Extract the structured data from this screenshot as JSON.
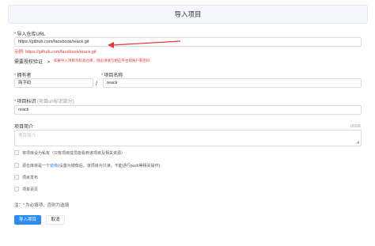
{
  "header": {
    "title": "导入项目"
  },
  "repo_url": {
    "label": "导入仓库URL",
    "value": "https://github.com/facebook/reack.git",
    "example_prefix": "示例:",
    "example_url": "https://github.com/facebook/reack.git"
  },
  "auth": {
    "label": "需要授权验证",
    "toggle_glyph": ">",
    "note": "如果导入项目为私有仓库，则必须填写相应平台的账户和密码"
  },
  "owner": {
    "label": "拥有者",
    "value": "商字码"
  },
  "separator": "/",
  "project_name": {
    "label": "项目名称",
    "value": "reack"
  },
  "project_id": {
    "label": "项目标识",
    "hint": "(项目url标识部分)",
    "value": "reack"
  },
  "description": {
    "label": "项目简介",
    "counter": "0/200",
    "placeholder": "项目简介"
  },
  "options": [
    {
      "label": "将项目设为私有（只有项目成员能看到该项目及相关资源）"
    },
    {
      "label_before": "源仓库将是一个",
      "link": "镜像",
      "label_after": "(设置为镜像后，该项目为只读，不能进行push等相关操作)"
    },
    {
      "label": "项目发布"
    },
    {
      "label": "项目百页"
    }
  ],
  "footnote": {
    "prefix": "注：",
    "star": "*",
    "text": "为必填项，否则为选填"
  },
  "buttons": {
    "submit": "导入项目",
    "cancel": "取消"
  },
  "colors": {
    "primary": "#2d8cf0",
    "required": "#e53935",
    "link": "#2d8cf0"
  }
}
